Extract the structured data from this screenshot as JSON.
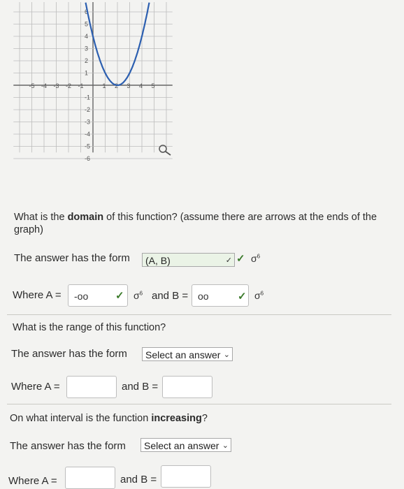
{
  "graph": {
    "x_ticks": [
      "-5",
      "-4",
      "-3",
      "-2",
      "-1",
      "1",
      "2",
      "3",
      "4",
      "5"
    ],
    "y_ticks": [
      "6",
      "5",
      "4",
      "3",
      "2",
      "1",
      "-1",
      "-2",
      "-3",
      "-4",
      "-5",
      "-6"
    ],
    "curve": {
      "type": "parabola",
      "vertex": [
        2,
        0
      ],
      "points": [
        [
          -1,
          9
        ],
        [
          0,
          4
        ],
        [
          1,
          1
        ],
        [
          2,
          0
        ],
        [
          3,
          1
        ],
        [
          4,
          4
        ],
        [
          5,
          9
        ]
      ]
    },
    "magnify_icon": "magnifier-icon",
    "colors": {
      "grid": "#bcbcbc",
      "axis": "#666666",
      "curve": "#2c5fb0"
    }
  },
  "q1": {
    "question_prefix": "What is the ",
    "question_bold": "domain",
    "question_suffix": " of this function? (assume there are arrows at the ends of the graph)",
    "form_label": "The answer has the form",
    "form_value": "(A, B)",
    "where_a_label": "Where A =",
    "a_value": "-oo",
    "and_b_label": "and B =",
    "b_value": "oo"
  },
  "q2": {
    "question": "What is the range of this function?",
    "form_label": "The answer has the form",
    "form_value": "Select an answer",
    "where_a_label": "Where A =",
    "and_b_label": "and B ="
  },
  "q3": {
    "question_prefix": "On what interval is the function ",
    "question_bold": "increasing",
    "question_suffix": "?",
    "form_label": "The answer has the form",
    "form_value": "Select an answer",
    "where_a_label": "Where A =",
    "and_b_label": "and B ="
  }
}
